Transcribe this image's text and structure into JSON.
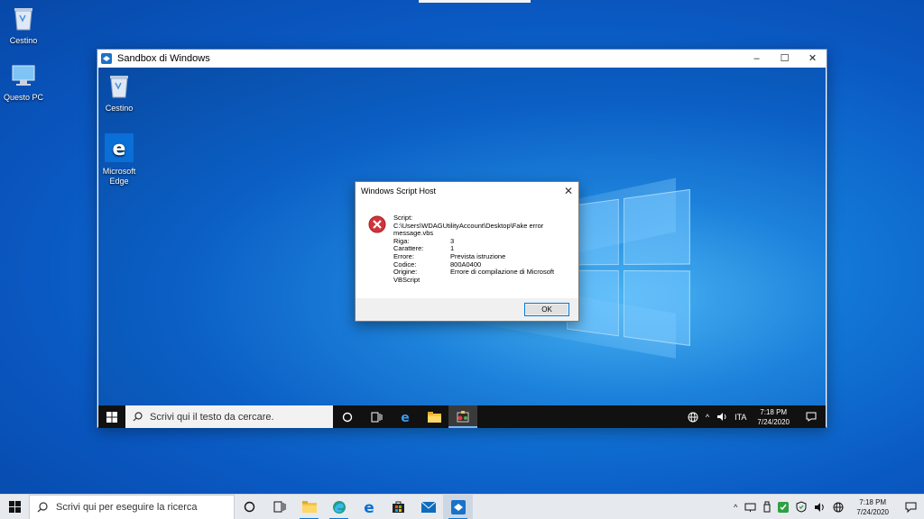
{
  "host": {
    "desktop_icons": [
      {
        "label": "Cestino",
        "icon": "recycle-bin-icon"
      },
      {
        "label": "Questo PC",
        "icon": "computer-icon"
      }
    ],
    "taskbar": {
      "search_placeholder": "Scrivi qui per eseguire la ricerca",
      "clock_time": "7:18 PM",
      "clock_date": "7/24/2020",
      "apps": [
        "cortana-icon",
        "task-view-icon",
        "file-explorer-icon",
        "edge-chromium-icon",
        "edge-legacy-icon",
        "store-icon",
        "mail-icon",
        "sandbox-icon"
      ]
    }
  },
  "sandbox": {
    "title": "Sandbox di Windows",
    "controls": {
      "minimize": "–",
      "maximize": "☐",
      "close": "✕"
    },
    "desktop_icons": [
      {
        "label": "Cestino",
        "icon": "recycle-bin-icon"
      },
      {
        "label": "Microsoft Edge",
        "icon": "edge-legacy-icon"
      }
    ],
    "taskbar": {
      "search_placeholder": "Scrivi qui il testo da cercare.",
      "language": "ITA",
      "clock_time": "7:18 PM",
      "clock_date": "7/24/2020"
    }
  },
  "dialog": {
    "title": "Windows Script Host",
    "close": "✕",
    "script_label": "Script:",
    "script_path": "C:\\Users\\WDAGUtilityAccount\\Desktop\\Fake error message.vbs",
    "rows": [
      {
        "key": "Riga:",
        "value": "3"
      },
      {
        "key": "Carattere:",
        "value": "1"
      },
      {
        "key": "Errore:",
        "value": "Prevista istruzione"
      },
      {
        "key": "Codice:",
        "value": "800A0400"
      },
      {
        "key": "Origine:",
        "value": "Errore di compilazione di Microsoft"
      }
    ],
    "origin_continued": "VBScript",
    "ok_label": "OK"
  },
  "colors": {
    "accent": "#0078d7",
    "error_red": "#d13438"
  }
}
